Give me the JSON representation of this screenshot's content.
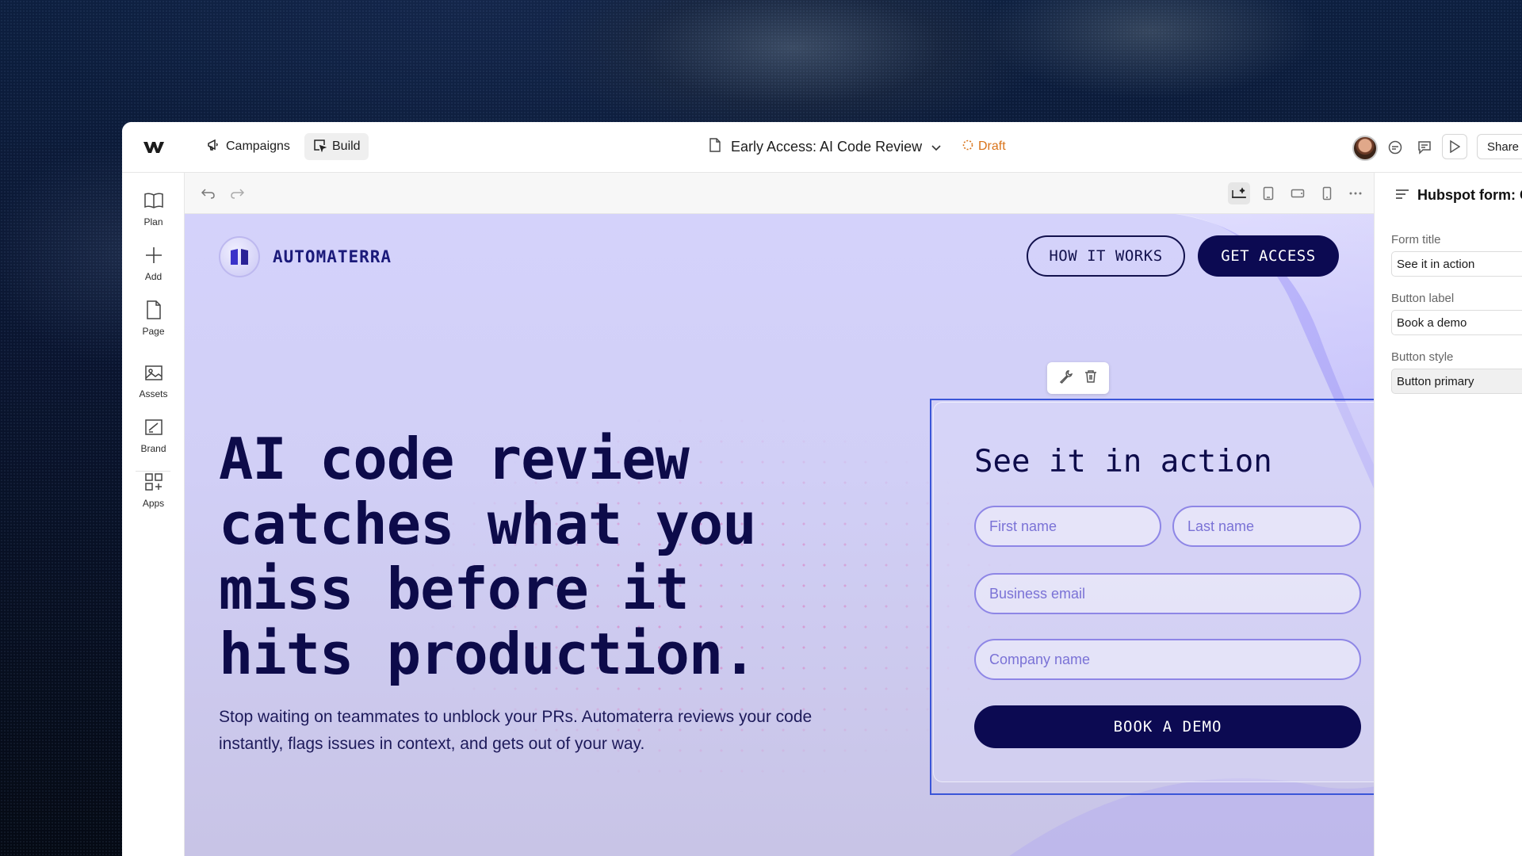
{
  "topbar": {
    "campaigns_label": "Campaigns",
    "build_label": "Build",
    "page_title": "Early Access: AI Code Review",
    "status": "Draft",
    "share_label": "Share"
  },
  "left_rail": {
    "items": [
      {
        "label": "Plan",
        "icon": "book-icon"
      },
      {
        "label": "Add",
        "icon": "plus-icon"
      },
      {
        "label": "Page",
        "icon": "page-icon"
      },
      {
        "label": "Assets",
        "icon": "image-icon"
      },
      {
        "label": "Brand",
        "icon": "brand-icon"
      },
      {
        "label": "Apps",
        "icon": "apps-icon"
      }
    ]
  },
  "right_panel": {
    "title": "Hubspot form: G",
    "form_title_label": "Form title",
    "form_title_value": "See it in action",
    "button_label_label": "Button label",
    "button_label_value": "Book a demo",
    "button_style_label": "Button style",
    "button_style_value": "Button primary"
  },
  "site": {
    "brand": "AUTOMATERRA",
    "nav": {
      "how_it_works": "HOW IT WORKS",
      "get_access": "GET ACCESS"
    },
    "hero": {
      "title": "AI code review catches what you miss before it hits production.",
      "subtitle": "Stop waiting on teammates to unblock your PRs. Automaterra reviews your code instantly, flags issues in context, and gets out of your way."
    },
    "form": {
      "title": "See it in action",
      "first_name_placeholder": "First name",
      "last_name_placeholder": "Last name",
      "email_placeholder": "Business email",
      "company_placeholder": "Company name",
      "submit_label": "BOOK A DEMO"
    }
  },
  "colors": {
    "accent_navy": "#0c0a52",
    "draft_orange": "#d9731a",
    "selection_blue": "#3a55d8"
  }
}
